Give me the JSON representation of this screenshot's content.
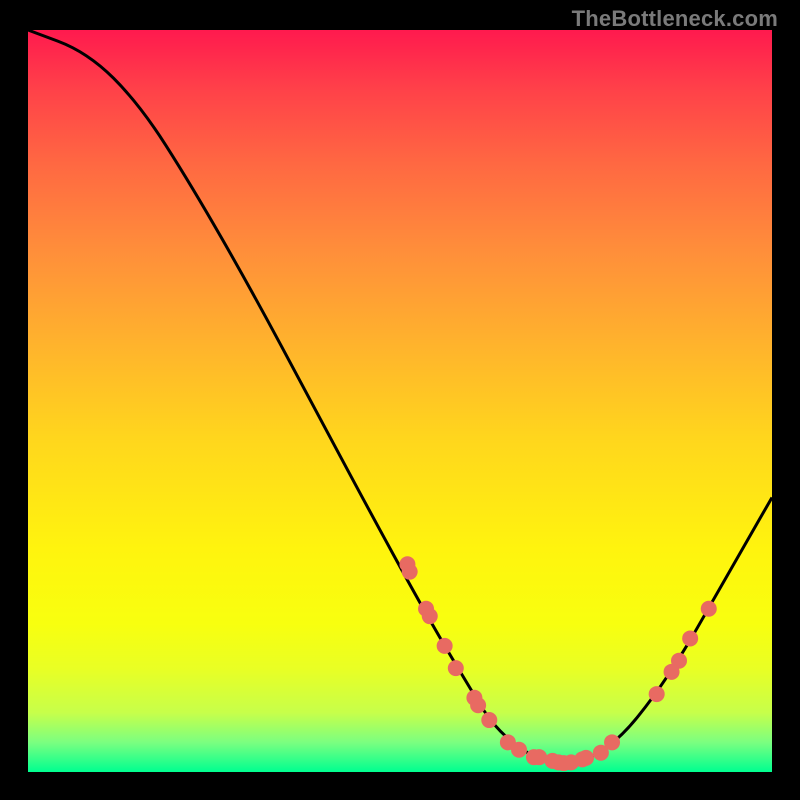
{
  "attribution": "TheBottleneck.com",
  "chart_data": {
    "type": "line",
    "title": "",
    "xlabel": "",
    "ylabel": "",
    "xlim": [
      0,
      100
    ],
    "ylim": [
      0,
      100
    ],
    "background": "heatmap-gradient",
    "curve": [
      {
        "x": 0,
        "y": 100
      },
      {
        "x": 8,
        "y": 97
      },
      {
        "x": 15,
        "y": 90
      },
      {
        "x": 22,
        "y": 79
      },
      {
        "x": 30,
        "y": 65
      },
      {
        "x": 38,
        "y": 50
      },
      {
        "x": 46,
        "y": 35
      },
      {
        "x": 52,
        "y": 24
      },
      {
        "x": 56,
        "y": 17
      },
      {
        "x": 59,
        "y": 12
      },
      {
        "x": 62,
        "y": 7
      },
      {
        "x": 65,
        "y": 4
      },
      {
        "x": 68,
        "y": 2
      },
      {
        "x": 72,
        "y": 1
      },
      {
        "x": 76,
        "y": 2
      },
      {
        "x": 80,
        "y": 5
      },
      {
        "x": 84,
        "y": 10
      },
      {
        "x": 88,
        "y": 16
      },
      {
        "x": 92,
        "y": 23
      },
      {
        "x": 96,
        "y": 30
      },
      {
        "x": 100,
        "y": 37
      }
    ],
    "markers": [
      {
        "x": 51,
        "y": 28
      },
      {
        "x": 51.3,
        "y": 27
      },
      {
        "x": 53.5,
        "y": 22
      },
      {
        "x": 54,
        "y": 21
      },
      {
        "x": 56,
        "y": 17
      },
      {
        "x": 57.5,
        "y": 14
      },
      {
        "x": 60,
        "y": 10
      },
      {
        "x": 60.5,
        "y": 9
      },
      {
        "x": 62,
        "y": 7
      },
      {
        "x": 64.5,
        "y": 4
      },
      {
        "x": 66,
        "y": 3
      },
      {
        "x": 68,
        "y": 2
      },
      {
        "x": 68.7,
        "y": 2
      },
      {
        "x": 70.5,
        "y": 1.5
      },
      {
        "x": 71.3,
        "y": 1.3
      },
      {
        "x": 72,
        "y": 1.2
      },
      {
        "x": 73,
        "y": 1.3
      },
      {
        "x": 74.5,
        "y": 1.7
      },
      {
        "x": 75,
        "y": 1.9
      },
      {
        "x": 77,
        "y": 2.6
      },
      {
        "x": 78.5,
        "y": 4
      },
      {
        "x": 84.5,
        "y": 10.5
      },
      {
        "x": 86.5,
        "y": 13.5
      },
      {
        "x": 87.5,
        "y": 15
      },
      {
        "x": 89,
        "y": 18
      },
      {
        "x": 91.5,
        "y": 22
      }
    ],
    "marker_color": "#e86a62",
    "marker_radius": 8
  }
}
